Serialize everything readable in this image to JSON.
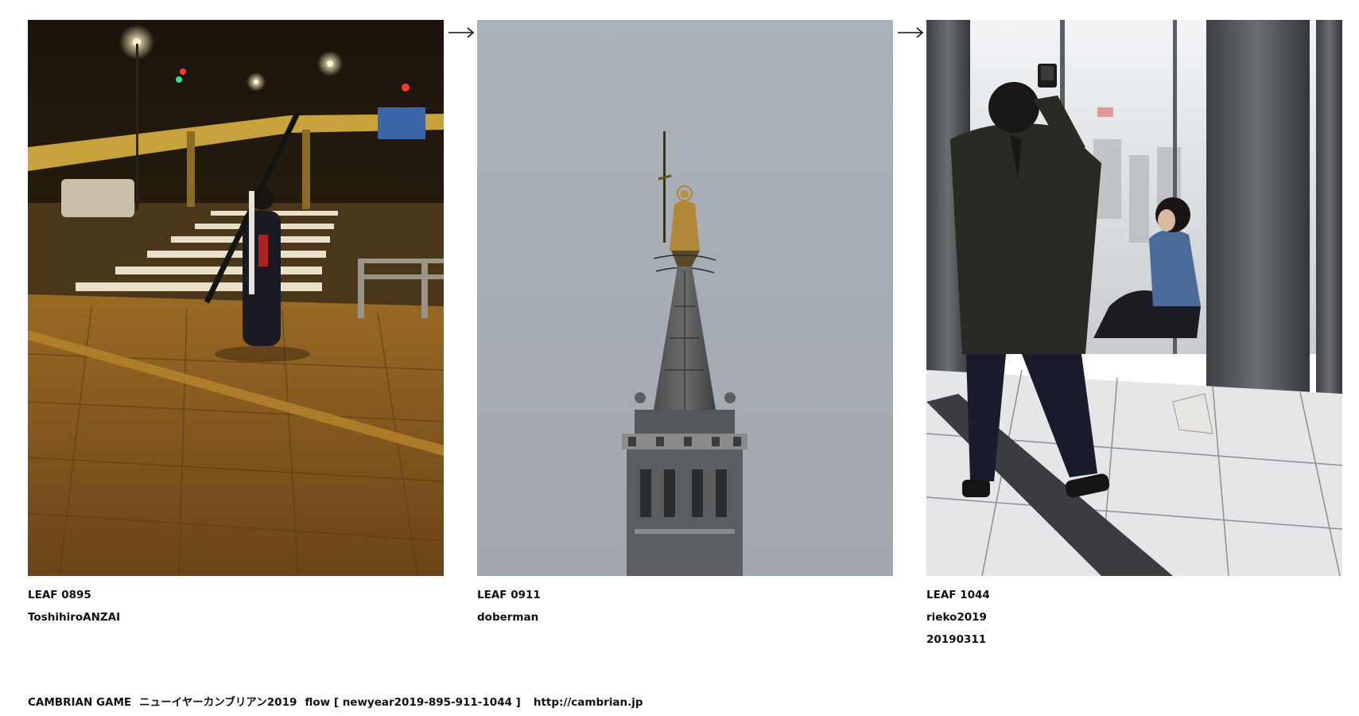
{
  "leaves": [
    {
      "id": "LEAF 0895",
      "author": "ToshihiroANZAI",
      "date": "",
      "scene": "night crosswalk with person carrying a long pole, overpass and street lights"
    },
    {
      "id": "LEAF 0911",
      "author": "doberman",
      "date": "",
      "scene": "cathedral spire topped by a golden statue against grey sky"
    },
    {
      "id": "LEAF 1044",
      "author": "rieko2019",
      "date": "20190311",
      "scene": "person photographing another person seated by a tall window with columns"
    }
  ],
  "arrows": [
    "→",
    "→"
  ],
  "footer": {
    "game": "CAMBRIAN GAME",
    "title": "ニューイヤーカンブリアン2019",
    "flow": "flow [ newyear2019-895-911-1044 ]",
    "url": "http://cambrian.jp"
  },
  "colors": {
    "text": "#111111",
    "background": "#ffffff",
    "night_tone": "#b07a2a",
    "sky_tone": "#a7adb4",
    "interior_tone": "#c9cbcc"
  }
}
